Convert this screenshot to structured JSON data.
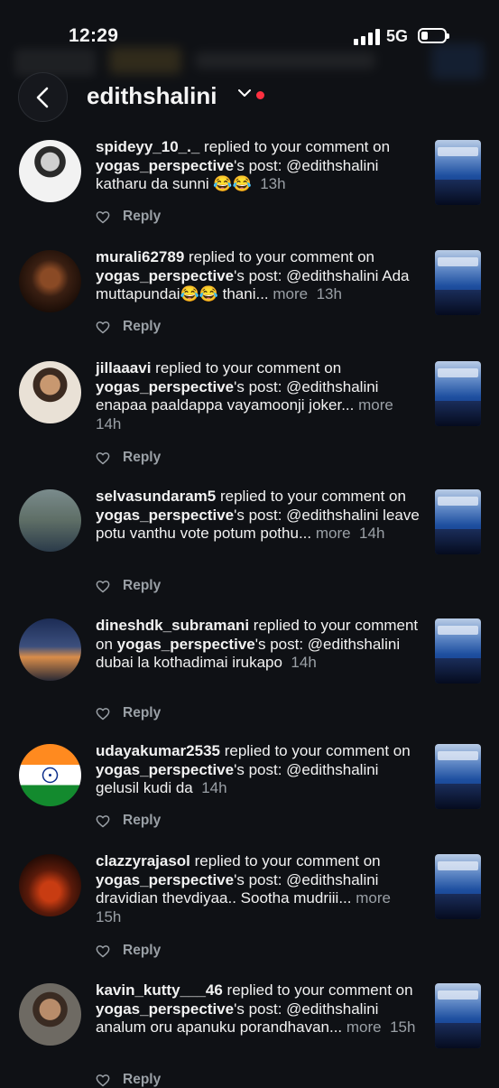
{
  "status_bar": {
    "time": "12:29",
    "network": "5G",
    "battery_level": 0.3
  },
  "header": {
    "title": "edithshalini"
  },
  "reply_label": "Reply",
  "notifications": [
    {
      "username": "spideyy_10_._",
      "action_pre": " replied to your comment on ",
      "post_owner": "yogas_perspective",
      "action_post": "'s post: @edithshalini katharu da sunni 😂😂",
      "more": "",
      "time": "13h"
    },
    {
      "username": "murali62789",
      "action_pre": " replied to your comment on ",
      "post_owner": "yogas_perspective",
      "action_post": "'s post: @edithshalini Ada muttapundai😂😂 thani...",
      "more": "more",
      "time": "13h"
    },
    {
      "username": "jillaaavi",
      "action_pre": " replied to your comment on ",
      "post_owner": "yogas_perspective",
      "action_post": "'s post: @edithshalini enapaa paaldappa vayamoonji joker...",
      "more": "more",
      "time": "14h"
    },
    {
      "username": "selvasundaram5",
      "action_pre": " replied to your comment on ",
      "post_owner": "yogas_perspective",
      "action_post": "'s post: @edithshalini leave potu vanthu vote potum pothu...",
      "more": "more",
      "time": "14h"
    },
    {
      "username": "dineshdk_subramani",
      "action_pre": " replied to your comment on ",
      "post_owner": "yogas_perspective",
      "action_post": "'s post: @edithshalini dubai la kothadimai irukapo",
      "more": "",
      "time": "14h"
    },
    {
      "username": "udayakumar2535",
      "action_pre": " replied to your comment on ",
      "post_owner": "yogas_perspective",
      "action_post": "'s post: @edithshalini gelusil kudi da",
      "more": "",
      "time": "14h"
    },
    {
      "username": "clazzyrajasol",
      "action_pre": " replied to your comment on ",
      "post_owner": "yogas_perspective",
      "action_post": "'s post: @edithshalini dravidian thevdiyaa.. Sootha mudriii...",
      "more": "more",
      "time": "15h"
    },
    {
      "username": "kavin_kutty___46",
      "action_pre": " replied to your comment on ",
      "post_owner": "yogas_perspective",
      "action_post": "'s post: @edithshalini analum oru apanuku porandhavan...",
      "more": "more",
      "time": "15h"
    }
  ],
  "colors": {
    "background": "#0f1115",
    "meta": "#9aa0a6",
    "notification_dot": "#ff3040"
  },
  "icons": {
    "back": "chevron-left-icon",
    "dropdown": "chevron-down-icon",
    "like": "heart-icon"
  }
}
